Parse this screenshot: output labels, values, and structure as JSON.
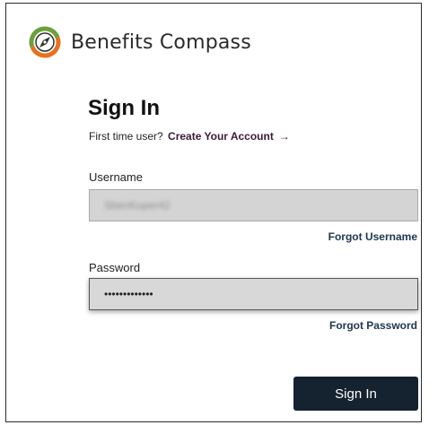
{
  "brand": {
    "name": "Benefits Compass",
    "logo_colors": {
      "orange": "#e8701e",
      "green": "#6aa13a",
      "dark": "#2f2f2f"
    }
  },
  "signin": {
    "title": "Sign In",
    "first_time_prompt": "First time user?",
    "create_account_label": "Create Your Account",
    "create_account_arrow": "→"
  },
  "username": {
    "label": "Username",
    "value": "SbenKuper42",
    "forgot_label": "Forgot Username"
  },
  "password": {
    "label": "Password",
    "value": "•••••••••••••",
    "forgot_label": "Forgot Password"
  },
  "actions": {
    "submit_label": "Sign In"
  },
  "colors": {
    "button_bg": "#152230",
    "link_purple": "#3b1a3a",
    "link_navy": "#1f3550",
    "input_bg": "#d4d4d4"
  }
}
